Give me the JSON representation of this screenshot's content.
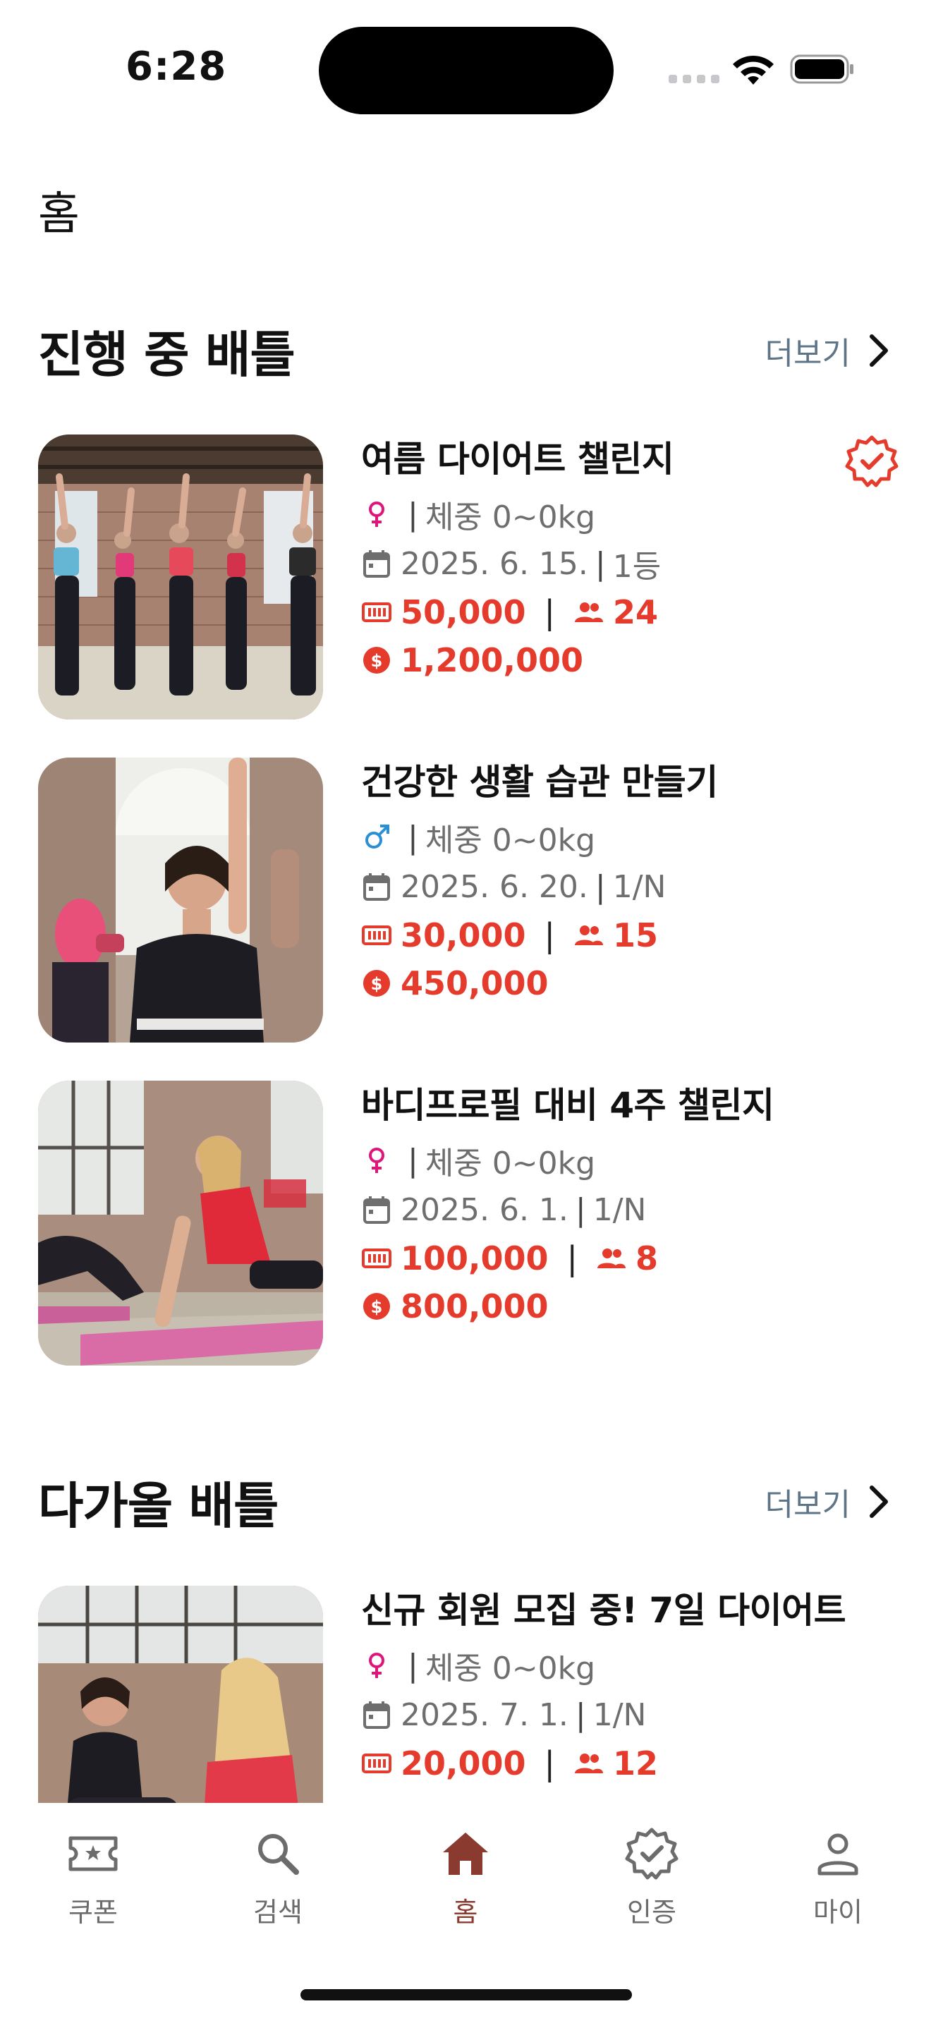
{
  "status": {
    "time": "6:28"
  },
  "page_title": "홈",
  "sections": [
    {
      "title": "진행 중 배틀",
      "more": "더보기",
      "items": [
        {
          "title": "여름 다이어트 챌린지",
          "gender": "female",
          "weight": "체중 0~0kg",
          "date": "2025. 6. 15.",
          "rank": "1등",
          "fee": "50,000",
          "participants": "24",
          "prize": "1,200,000",
          "verified": true
        },
        {
          "title": "건강한 생활 습관 만들기",
          "gender": "male",
          "weight": "체중 0~0kg",
          "date": "2025. 6. 20.",
          "rank": "1/N",
          "fee": "30,000",
          "participants": "15",
          "prize": "450,000",
          "verified": false
        },
        {
          "title": "바디프로필 대비 4주 챌린지",
          "gender": "female",
          "weight": "체중 0~0kg",
          "date": "2025. 6. 1.",
          "rank": "1/N",
          "fee": "100,000",
          "participants": "8",
          "prize": "800,000",
          "verified": false
        }
      ]
    },
    {
      "title": "다가올 배틀",
      "more": "더보기",
      "items": [
        {
          "title": "신규 회원 모집 중! 7일 다이어트",
          "gender": "female",
          "weight": "체중 0~0kg",
          "date": "2025. 7. 1.",
          "rank": "1/N",
          "fee": "20,000",
          "participants": "12"
        }
      ]
    }
  ],
  "tabs": [
    {
      "label": "쿠폰",
      "icon": "ticket-star-icon",
      "active": false
    },
    {
      "label": "검색",
      "icon": "search-icon",
      "active": false
    },
    {
      "label": "홈",
      "icon": "home-icon",
      "active": true
    },
    {
      "label": "인증",
      "icon": "verified-badge-icon",
      "active": false
    },
    {
      "label": "마이",
      "icon": "person-icon",
      "active": false
    }
  ],
  "colors": {
    "accent_red": "#e53b2c",
    "female": "#e0157a",
    "male": "#2b8fd6",
    "tab_active": "#8b3a2f",
    "more_link": "#5e7487"
  }
}
